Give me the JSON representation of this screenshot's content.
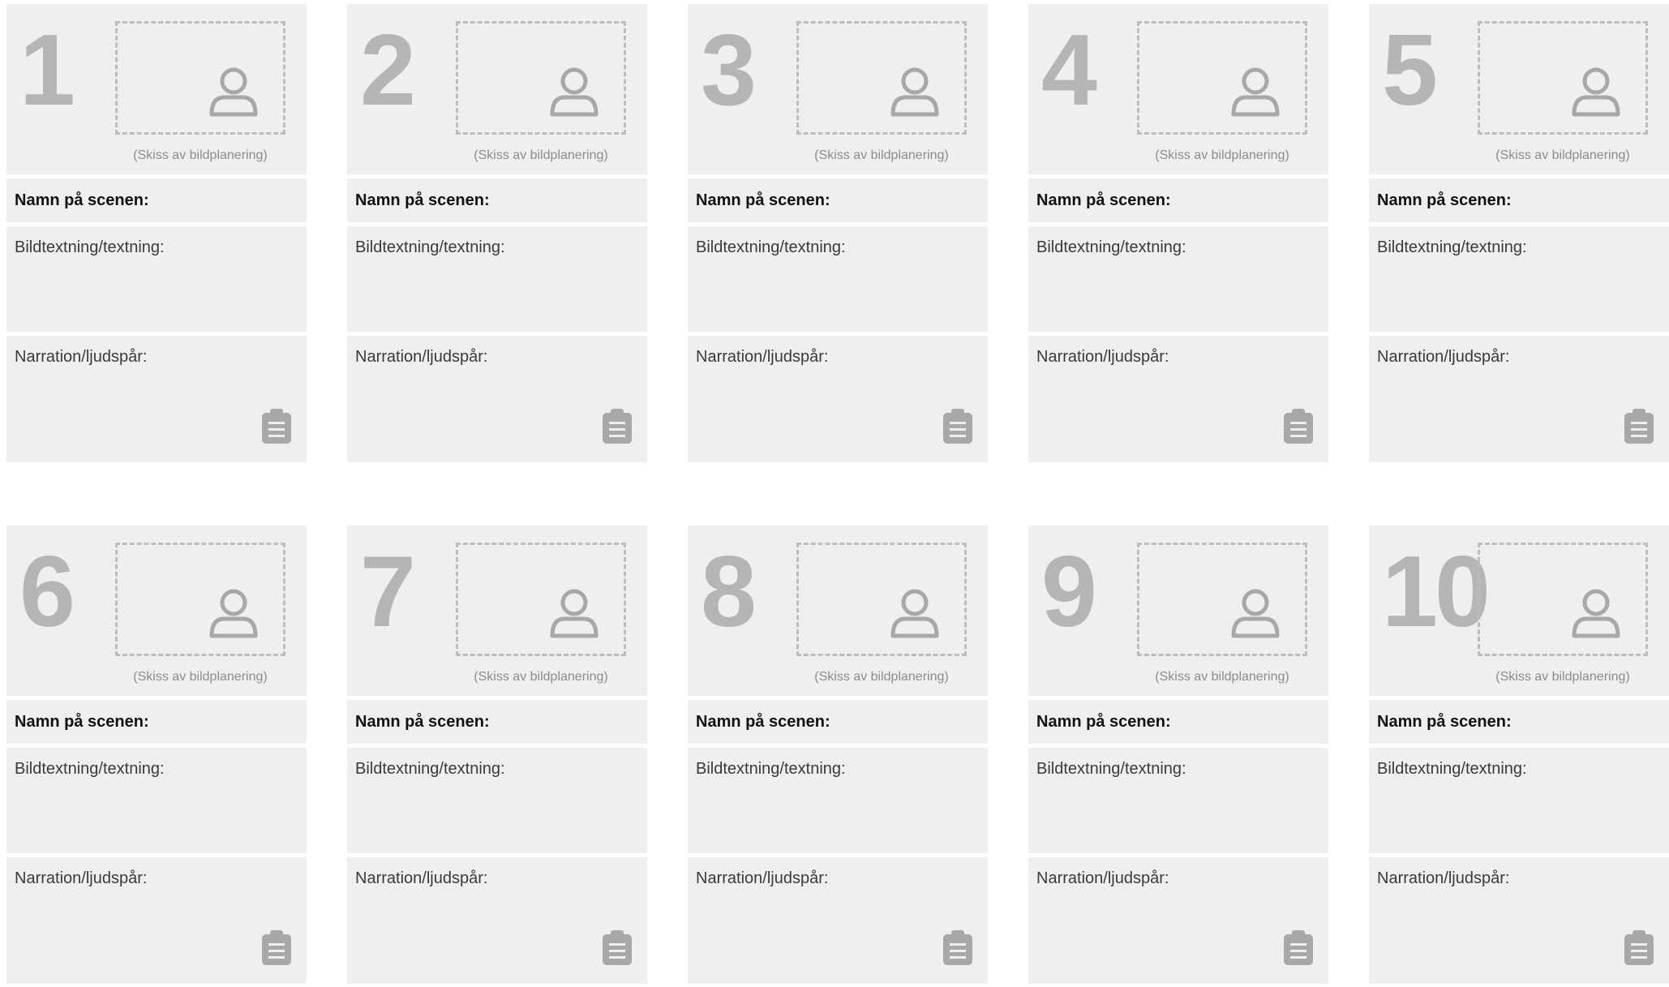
{
  "labels": {
    "sketch_caption": "(Skiss av bildplanering)",
    "scene_name": "Namn på scenen:",
    "caption_text": "Bildtextning/textning:",
    "narration": "Narration/ljudspår:"
  },
  "icons": {
    "frame_icon": "user-icon",
    "notes_icon": "clipboard-icon"
  },
  "colors": {
    "panel": "#efefef",
    "number": "#b5b5b5",
    "icon": "#a8a8a8"
  },
  "scenes": [
    {
      "number": "1"
    },
    {
      "number": "2"
    },
    {
      "number": "3"
    },
    {
      "number": "4"
    },
    {
      "number": "5"
    },
    {
      "number": "6"
    },
    {
      "number": "7"
    },
    {
      "number": "8"
    },
    {
      "number": "9"
    },
    {
      "number": "10"
    }
  ]
}
